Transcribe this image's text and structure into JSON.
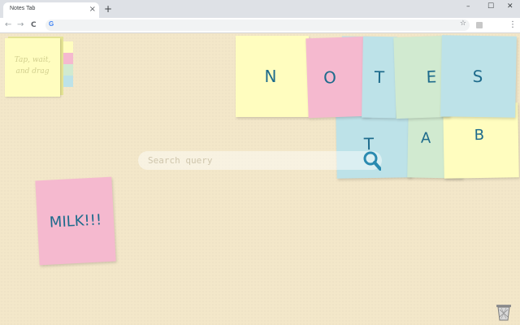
{
  "browser": {
    "tab_title": "Notes Tab",
    "tab_close": "×",
    "new_tab": "+",
    "window_controls": [
      "–",
      "☐",
      "✕"
    ],
    "back": "←",
    "forward": "→",
    "reload": "C",
    "google_icon": "G",
    "bookmark_star": "☆",
    "menu": "⋮"
  },
  "palette": {
    "hint_line1": "Tap, wait,",
    "hint_line2": "and drag",
    "swatch_colors": [
      "#fffdbf",
      "#f5b9cf",
      "#d1ead0",
      "#bde2e8"
    ]
  },
  "title_notes": {
    "row1": [
      "N",
      "O",
      "T",
      "E",
      "S"
    ],
    "row2": [
      "T",
      "A",
      "B"
    ]
  },
  "search": {
    "placeholder": "Search query"
  },
  "sticky_note": {
    "text": "MILK!!!"
  },
  "colors": {
    "yellow": "#fffdbf",
    "pink": "#f5b9cf",
    "blue": "#bde2e8",
    "green": "#d1ead0",
    "text": "#1e6b8c"
  },
  "icons": [
    "search-icon",
    "trash-icon"
  ]
}
